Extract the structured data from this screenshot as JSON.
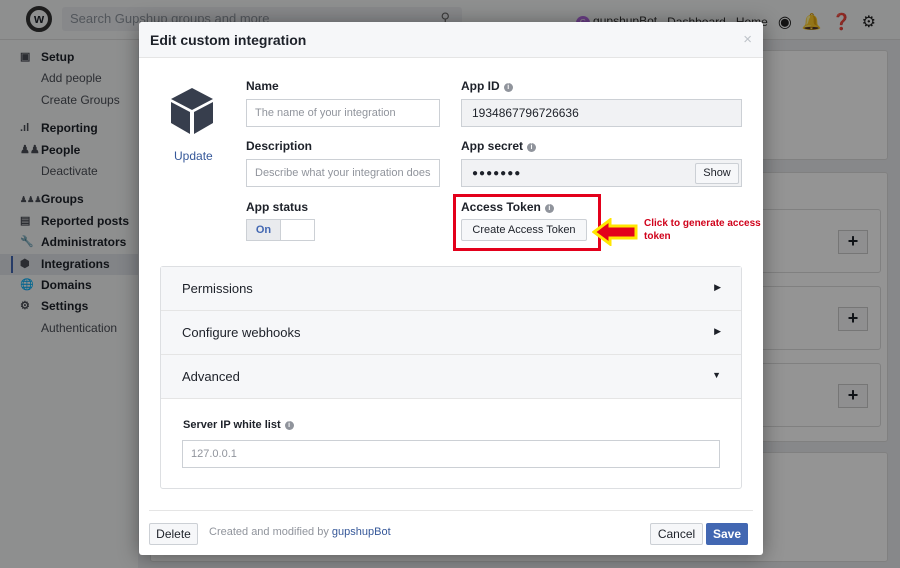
{
  "topbar": {
    "search_placeholder": "Search Gupshup groups and more",
    "user": "gupshupBot",
    "user_initial": "G",
    "dashboard": "Dashboard",
    "home": "Home"
  },
  "sidebar": {
    "items": [
      {
        "label": "Setup",
        "icon": "monitor-icon",
        "type": "group"
      },
      {
        "label": "Add people",
        "type": "sub"
      },
      {
        "label": "Create Groups",
        "type": "sub"
      },
      {
        "label": "Reporting",
        "icon": "bar-chart-icon",
        "type": "group"
      },
      {
        "label": "People",
        "icon": "people-icon",
        "type": "group"
      },
      {
        "label": "Deactivate",
        "type": "sub"
      },
      {
        "label": "Groups",
        "icon": "groups-icon",
        "type": "group"
      },
      {
        "label": "Reported posts",
        "icon": "post-icon",
        "type": "group"
      },
      {
        "label": "Administrators",
        "icon": "wrench-icon",
        "type": "group"
      },
      {
        "label": "Integrations",
        "icon": "cube-icon",
        "type": "group",
        "active": true
      },
      {
        "label": "Domains",
        "icon": "globe-icon",
        "type": "group"
      },
      {
        "label": "Settings",
        "icon": "gear-icon",
        "type": "group"
      },
      {
        "label": "Authentication",
        "type": "sub"
      }
    ]
  },
  "modal": {
    "title": "Edit custom integration",
    "close": "×",
    "update": "Update",
    "name_label": "Name",
    "name_placeholder": "The name of your integration",
    "desc_label": "Description",
    "desc_placeholder": "Describe what your integration does",
    "status_label": "App status",
    "status_on": "On",
    "appid_label": "App ID",
    "appid_value": "1934867796726636",
    "secret_label": "App secret",
    "secret_value": "●●●●●●●",
    "show": "Show",
    "token_label": "Access Token",
    "token_button": "Create Access Token",
    "annotation": "Click to generate access token",
    "sections": [
      {
        "label": "Permissions",
        "state": "collapsed"
      },
      {
        "label": "Configure webhooks",
        "state": "collapsed"
      },
      {
        "label": "Advanced",
        "state": "expanded"
      }
    ],
    "ip_label": "Server IP white list",
    "ip_placeholder": "127.0.0.1",
    "delete": "Delete",
    "created_prefix": "Created and modified by",
    "created_by": "gupshupBot",
    "cancel": "Cancel",
    "save": "Save"
  },
  "colors": {
    "accent": "#4267b2",
    "annotation": "#e3001b",
    "arrow_fill": "#e3001b",
    "arrow_outline": "#ffe600"
  }
}
